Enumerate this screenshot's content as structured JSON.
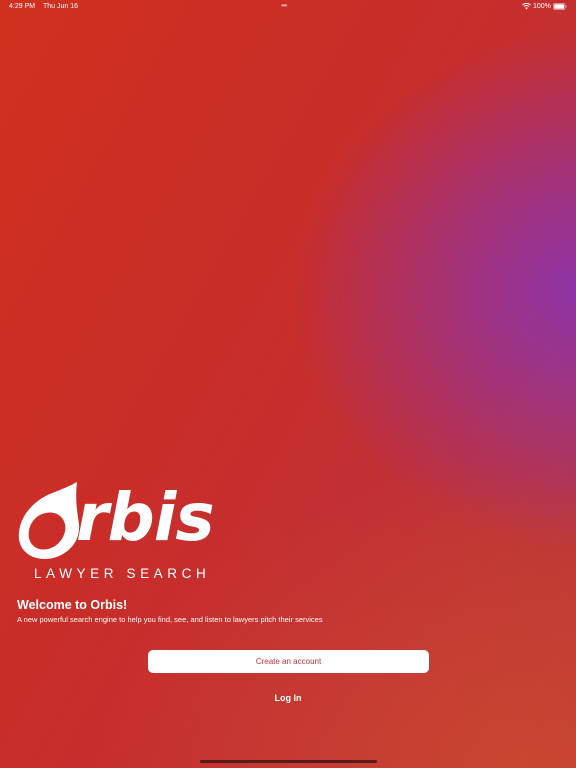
{
  "status_bar": {
    "time": "4:29 PM",
    "date": "Thu Jun 16",
    "battery": "100%"
  },
  "logo": {
    "wordmark": "rbis",
    "tagline": "LAWYER SEARCH"
  },
  "welcome": {
    "title": "Welcome to Orbis!",
    "subtitle": "A new powerful search engine to help you find, see, and listen to lawyers pitch their services"
  },
  "actions": {
    "create_account": "Create an account",
    "log_in": "Log In"
  },
  "colors": {
    "background_red": "#d0301e",
    "background_purple": "#8a34b0",
    "button_text": "#c6323a"
  }
}
